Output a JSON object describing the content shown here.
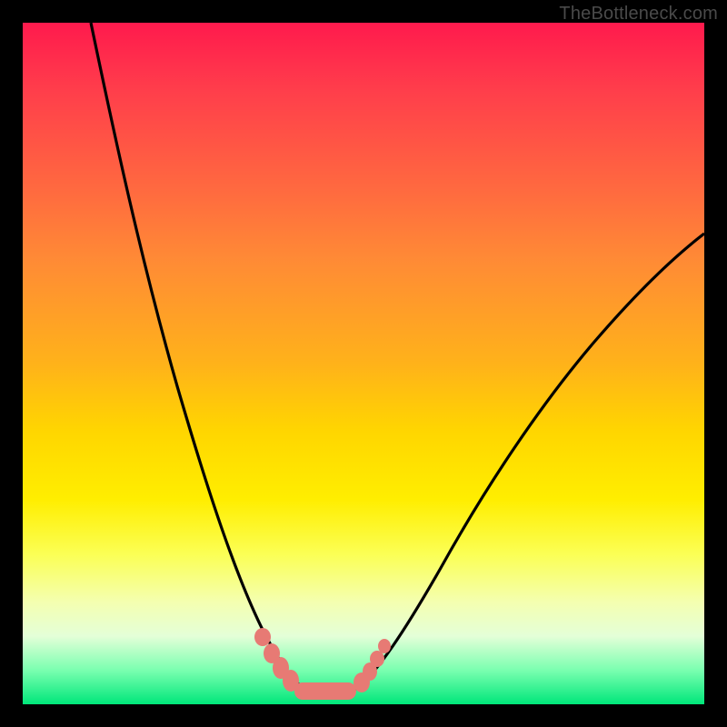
{
  "watermark": "TheBottleneck.com",
  "chart_data": {
    "type": "line",
    "title": "",
    "xlabel": "",
    "ylabel": "",
    "xlim": [
      0,
      100
    ],
    "ylim": [
      0,
      100
    ],
    "series": [
      {
        "name": "left-branch",
        "x": [
          10,
          12,
          14,
          16,
          18,
          20,
          22,
          24,
          26,
          28,
          30,
          32,
          34,
          36,
          38,
          40
        ],
        "y": [
          100,
          90,
          80,
          70,
          61,
          52,
          44,
          36,
          29,
          22,
          16,
          11,
          7,
          4,
          2,
          1
        ]
      },
      {
        "name": "trough",
        "x": [
          40,
          42,
          44,
          46,
          48
        ],
        "y": [
          1,
          0.7,
          0.6,
          0.7,
          1
        ]
      },
      {
        "name": "right-branch",
        "x": [
          48,
          52,
          56,
          60,
          64,
          68,
          72,
          76,
          80,
          84,
          88,
          92,
          96,
          100
        ],
        "y": [
          1,
          4,
          8,
          13,
          19,
          25,
          31,
          37,
          43,
          49,
          54,
          59,
          64,
          68
        ]
      }
    ],
    "marker_points": {
      "comment": "pink lozenge markers near trough",
      "x": [
        34,
        36,
        38,
        40,
        42,
        44,
        46,
        48,
        49,
        50,
        51
      ],
      "y": [
        9,
        6,
        4,
        2.5,
        2,
        2,
        2,
        3,
        5,
        7,
        9
      ]
    },
    "colors": {
      "curve": "#000000",
      "markers": "#e77a74",
      "gradient_top": "#ff1a4d",
      "gradient_mid": "#ffd600",
      "gradient_bottom": "#00e67a"
    }
  }
}
